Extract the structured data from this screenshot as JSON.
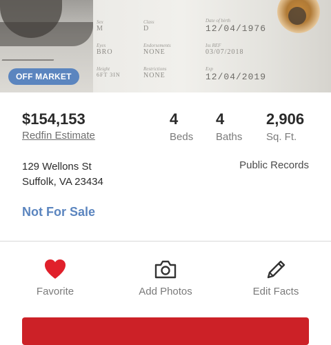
{
  "photo": {
    "badge": "OFF MARKET",
    "license_fields": [
      {
        "label": "Sex",
        "value": "M"
      },
      {
        "label": "Class",
        "value": "D"
      },
      {
        "label": "Date of birth",
        "value": "12/04/1976"
      },
      {
        "label": "Eyes",
        "value": "BRO"
      },
      {
        "label": "Endorsements",
        "value": "NONE"
      },
      {
        "label": "Iss REF",
        "value": "03/07/2018"
      },
      {
        "label": "Height",
        "value": "6FT 3IN"
      },
      {
        "label": "Restrictions",
        "value": "NONE"
      },
      {
        "label": "Exp",
        "value": "12/04/2019"
      }
    ]
  },
  "summary": {
    "price": "$154,153",
    "price_label": "Redfin Estimate",
    "beds_value": "4",
    "beds_label": "Beds",
    "baths_value": "4",
    "baths_label": "Baths",
    "sqft_value": "2,906",
    "sqft_label": "Sq. Ft."
  },
  "address": {
    "street": "129 Wellons St",
    "city_state_zip": "Suffolk, VA 23434",
    "source": "Public Records"
  },
  "status_text": "Not For Sale",
  "actions": [
    {
      "label": "Favorite",
      "icon": "heart-icon",
      "color": "#e0202b"
    },
    {
      "label": "Add Photos",
      "icon": "camera-icon"
    },
    {
      "label": "Edit Facts",
      "icon": "pencil-icon"
    }
  ],
  "colors": {
    "accent_blue": "#5b85bf",
    "brand_red": "#cc2127",
    "favorite_red": "#e0202b"
  }
}
